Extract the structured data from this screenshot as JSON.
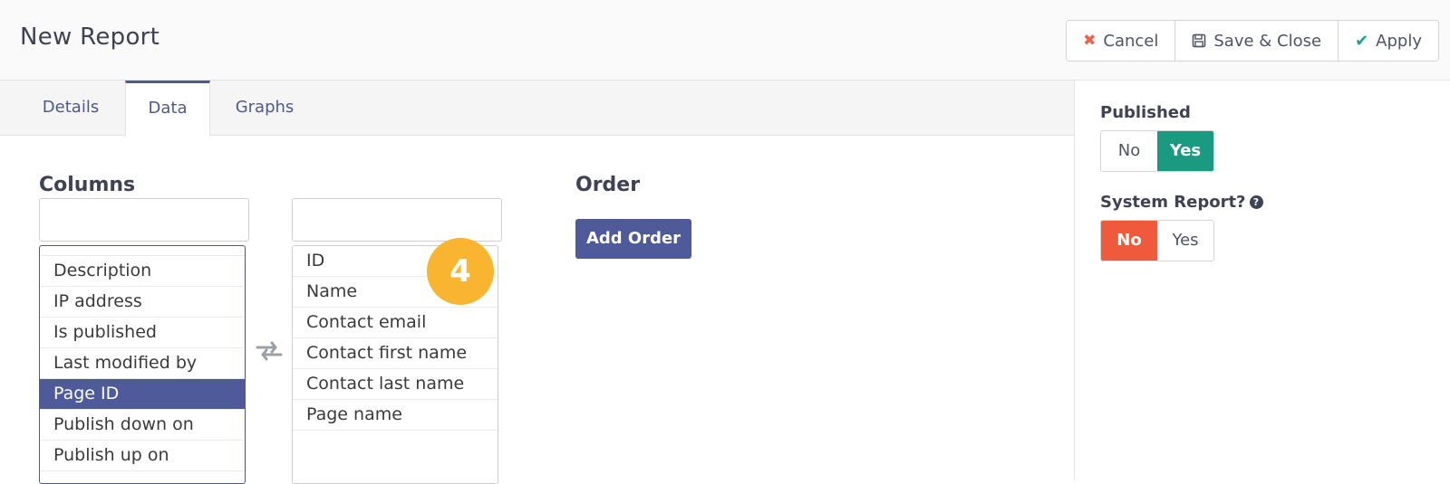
{
  "header": {
    "title": "New Report",
    "buttons": {
      "cancel": "Cancel",
      "save_close": "Save & Close",
      "apply": "Apply"
    }
  },
  "tabs": [
    {
      "label": "Details",
      "active": false
    },
    {
      "label": "Data",
      "active": true
    },
    {
      "label": "Graphs",
      "active": false
    }
  ],
  "columns": {
    "title": "Columns",
    "available_search": "",
    "selected_search": "",
    "available": [
      "Description",
      "IP address",
      "Is published",
      "Last modified by",
      "Page ID",
      "Publish down on",
      "Publish up on"
    ],
    "available_selected_item": "Page ID",
    "selected": [
      "ID",
      "Name",
      "Contact email",
      "Contact first name",
      "Contact last name",
      "Page name"
    ]
  },
  "marker": "4",
  "order": {
    "title": "Order",
    "add_button": "Add Order"
  },
  "sidebar": {
    "published_label": "Published",
    "published_options": [
      "No",
      "Yes"
    ],
    "published_value": "Yes",
    "system_label": "System Report?",
    "system_options": [
      "No",
      "Yes"
    ],
    "system_value": "No"
  },
  "colors": {
    "accent": "#4e5a9a",
    "green": "#1a9a80",
    "red": "#f05a3c",
    "marker": "#f9b530"
  },
  "icons": {
    "cancel": "times-icon",
    "save": "save-icon",
    "apply": "check-icon",
    "swap": "swap-arrows-icon",
    "help": "question-circle-icon"
  }
}
